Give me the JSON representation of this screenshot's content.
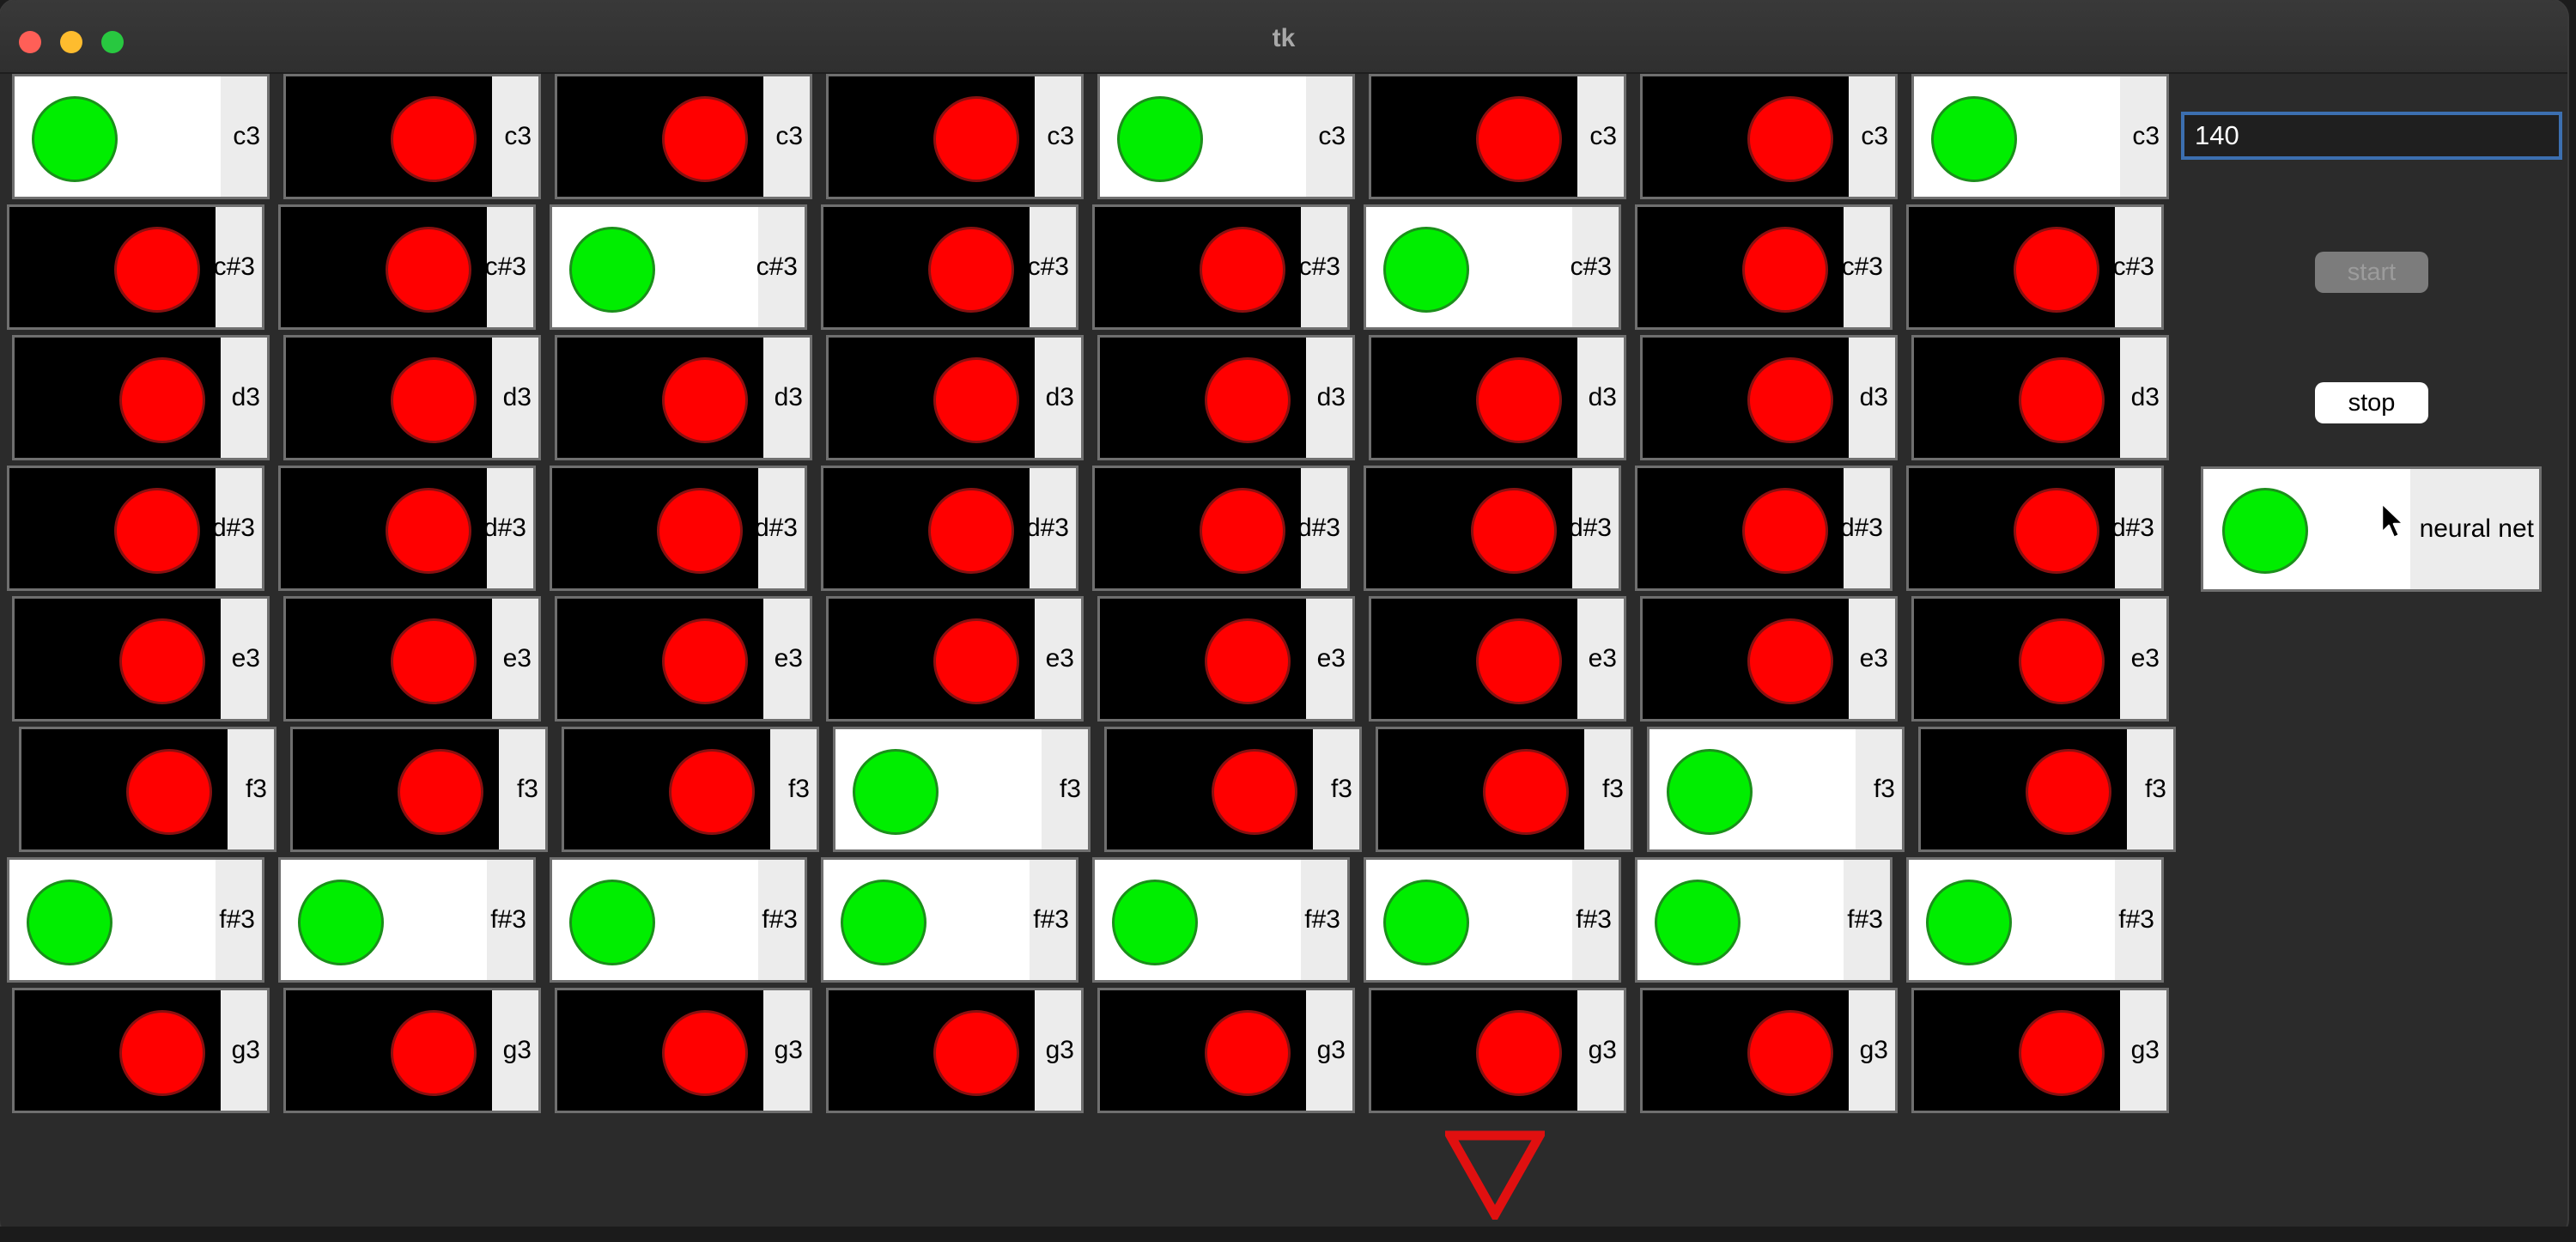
{
  "window": {
    "title": "tk"
  },
  "grid": {
    "rows": [
      {
        "label": "c3",
        "states": [
          true,
          false,
          false,
          false,
          true,
          false,
          false,
          true
        ]
      },
      {
        "label": "c#3",
        "states": [
          false,
          false,
          true,
          false,
          false,
          true,
          false,
          false
        ]
      },
      {
        "label": "d3",
        "states": [
          false,
          false,
          false,
          false,
          false,
          false,
          false,
          false
        ]
      },
      {
        "label": "d#3",
        "states": [
          false,
          false,
          false,
          false,
          false,
          false,
          false,
          false
        ]
      },
      {
        "label": "e3",
        "states": [
          false,
          false,
          false,
          false,
          false,
          false,
          false,
          false
        ]
      },
      {
        "label": "f3",
        "states": [
          false,
          false,
          false,
          true,
          false,
          false,
          true,
          false
        ]
      },
      {
        "label": "f#3",
        "states": [
          true,
          true,
          true,
          true,
          true,
          true,
          true,
          true
        ]
      },
      {
        "label": "g3",
        "states": [
          false,
          false,
          false,
          false,
          false,
          false,
          false,
          false
        ]
      }
    ]
  },
  "controls": {
    "tempo_value": "140",
    "start_label": "start",
    "stop_label": "stop",
    "neural_net_label": "neural net",
    "neural_net_on": true
  },
  "icons": {
    "cursor": "mouse-pointer-icon",
    "indicator": "red-down-triangle-icon"
  },
  "colors": {
    "on_dot": "#00ee00",
    "off_dot": "#ff0000",
    "off_field": "#000000",
    "on_field": "#ffffff"
  }
}
